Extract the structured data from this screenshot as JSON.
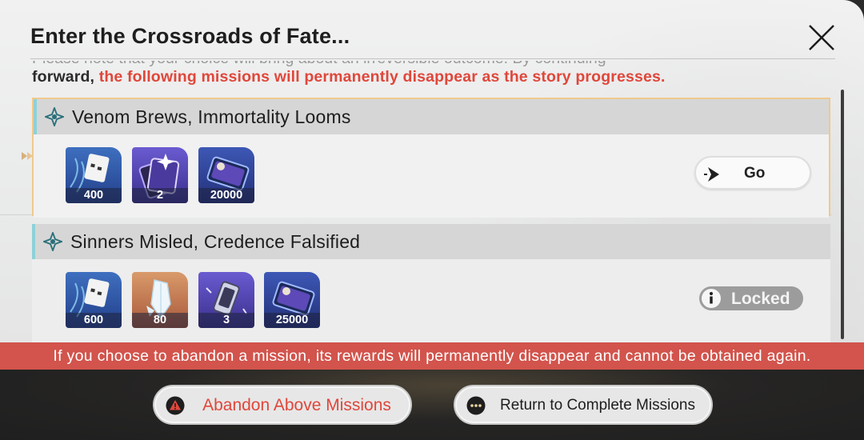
{
  "dialog": {
    "title": "Enter the Crossroads of Fate...",
    "notice_partial": "Please note that your choice will bring about an irreversible outcome. By continuing",
    "notice_lead": "forward, ",
    "notice_warning": "the following missions will permanently disappear as the story progresses."
  },
  "missions": [
    {
      "title": "Venom Brews, Immortality Looms",
      "rewards": [
        {
          "icon": "credit-ticket-icon",
          "count": "400"
        },
        {
          "icon": "sparkle-card-icon",
          "count": "2"
        },
        {
          "icon": "currency-card-icon",
          "count": "20000"
        }
      ],
      "action_label": "Go",
      "state": "available"
    },
    {
      "title": "Sinners Misled, Credence Falsified",
      "rewards": [
        {
          "icon": "credit-ticket-icon",
          "count": "600"
        },
        {
          "icon": "crystal-icon",
          "count": "80"
        },
        {
          "icon": "lantern-icon",
          "count": "3"
        },
        {
          "icon": "currency-card-icon",
          "count": "25000"
        }
      ],
      "action_label": "Locked",
      "state": "locked"
    }
  ],
  "warning": "If you choose to abandon a mission, its rewards will permanently disappear and cannot be obtained again.",
  "buttons": {
    "abandon": "Abandon Above Missions",
    "return": "Return to Complete Missions"
  },
  "colors": {
    "warning_red": "#e0473b",
    "banner_red": "#d2544c",
    "selected_border": "#f0c98c",
    "header_accent": "#8fd0d8"
  }
}
